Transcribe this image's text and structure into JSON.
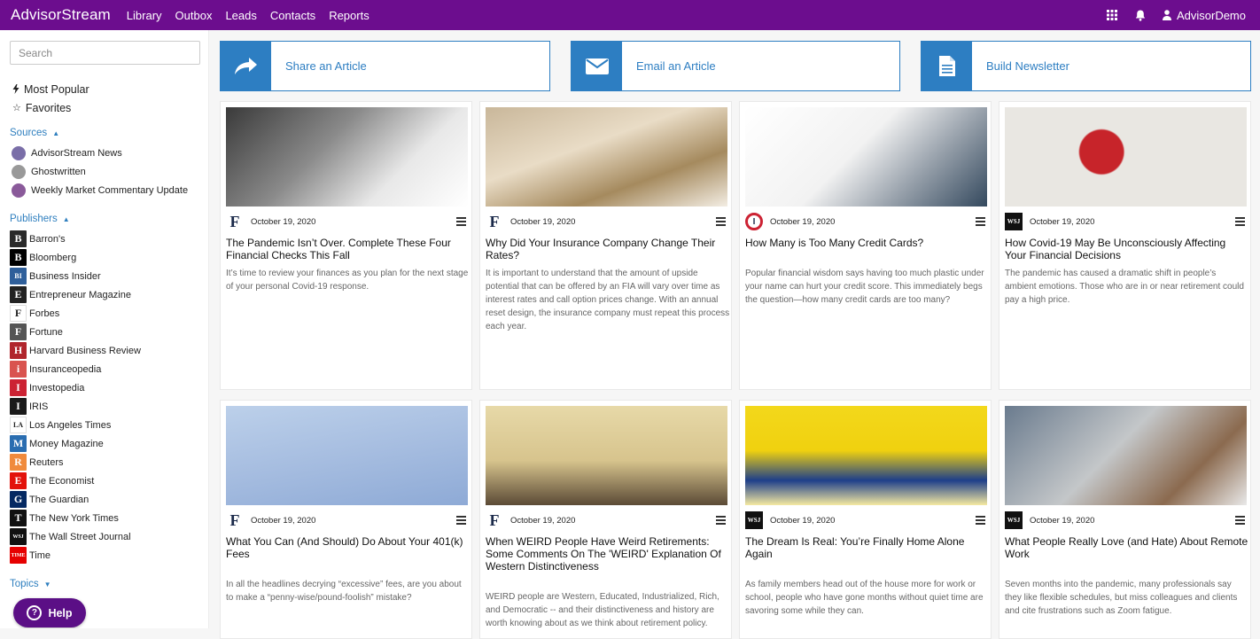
{
  "nav": {
    "brand": "AdvisorStream",
    "links": [
      "Library",
      "Outbox",
      "Leads",
      "Contacts",
      "Reports"
    ],
    "user": "AdvisorDemo"
  },
  "sidebar": {
    "search_placeholder": "Search",
    "quick": [
      {
        "label": "Most Popular",
        "icon": "bolt-icon"
      },
      {
        "label": "Favorites",
        "icon": "star-icon"
      }
    ],
    "sources_heading": "Sources",
    "sources": [
      {
        "label": "AdvisorStream News",
        "color": "#7a6ea8"
      },
      {
        "label": "Ghostwritten",
        "color": "#999999"
      },
      {
        "label": "Weekly Market Commentary Update",
        "color": "#8a5a9a"
      }
    ],
    "publishers_heading": "Publishers",
    "publishers": [
      {
        "label": "Barron's",
        "mark": "B",
        "color": "#2a2a2a"
      },
      {
        "label": "Bloomberg",
        "mark": "B",
        "color": "#000000"
      },
      {
        "label": "Business Insider",
        "mark": "BI",
        "color": "#2f5f9a"
      },
      {
        "label": "Entrepreneur Magazine",
        "mark": "E",
        "color": "#222222"
      },
      {
        "label": "Forbes",
        "mark": "F",
        "color": "#ffffff"
      },
      {
        "label": "Fortune",
        "mark": "F",
        "color": "#555555"
      },
      {
        "label": "Harvard Business Review",
        "mark": "H",
        "color": "#b0252c"
      },
      {
        "label": "Insuranceopedia",
        "mark": "i",
        "color": "#d9534f"
      },
      {
        "label": "Investopedia",
        "mark": "I",
        "color": "#cc2233"
      },
      {
        "label": "IRIS",
        "mark": "I",
        "color": "#1a1a1a"
      },
      {
        "label": "Los Angeles Times",
        "mark": "LA",
        "color": "#ffffff"
      },
      {
        "label": "Money Magazine",
        "mark": "M",
        "color": "#2a6db0"
      },
      {
        "label": "Reuters",
        "mark": "R",
        "color": "#f08a3c"
      },
      {
        "label": "The Economist",
        "mark": "E",
        "color": "#e3120b"
      },
      {
        "label": "The Guardian",
        "mark": "G",
        "color": "#052962"
      },
      {
        "label": "The New York Times",
        "mark": "T",
        "color": "#111111"
      },
      {
        "label": "The Wall Street Journal",
        "mark": "WSJ",
        "color": "#111111"
      },
      {
        "label": "Time",
        "mark": "TIME",
        "color": "#e60000"
      }
    ],
    "topics_heading": "Topics",
    "help_label": "Help"
  },
  "actions": [
    {
      "label": "Share an Article",
      "icon": "share-arrow-icon"
    },
    {
      "label": "Email an Article",
      "icon": "envelope-icon"
    },
    {
      "label": "Build Newsletter",
      "icon": "document-icon"
    }
  ],
  "accent": "#2d7ec2",
  "brand_color": "#6c0d8e",
  "articles": [
    {
      "publisher": "Forbes",
      "date": "October 19, 2020",
      "title": "The Pandemic Isn’t Over. Complete These Four Financial Checks This Fall",
      "desc": "It’s time to review your finances as you plan for the next stage of your personal Covid-19 response."
    },
    {
      "publisher": "Forbes",
      "date": "October 19, 2020",
      "title": "Why Did Your Insurance Company Change Their Rates?",
      "desc": "It is important to understand that the amount of upside potential that can be offered by an FIA will vary over time as interest rates and call option prices change. With an annual reset design, the insurance company must repeat this process each year."
    },
    {
      "publisher": "Investopedia",
      "date": "October 19, 2020",
      "title": "How Many is Too Many Credit Cards?",
      "desc": "Popular financial wisdom says having too much plastic under your name can hurt your credit score. This immediately begs the question—how many credit cards are too many?"
    },
    {
      "publisher": "WSJ",
      "date": "October 19, 2020",
      "title": "How Covid-19 May Be Unconsciously Affecting Your Financial Decisions",
      "desc": "The pandemic has caused a dramatic shift in people’s ambient emotions. Those who are in or near retirement could pay a high price."
    },
    {
      "publisher": "Forbes",
      "date": "October 19, 2020",
      "title": "What You Can (And Should) Do About Your 401(k) Fees",
      "desc": "In all the headlines decrying “excessive” fees, are you about to make a “penny-wise/pound-foolish” mistake?"
    },
    {
      "publisher": "Forbes",
      "date": "October 19, 2020",
      "title": "When WEIRD People Have Weird Retirements: Some Comments On The 'WEIRD' Explanation Of Western Distinctiveness",
      "desc": "WEIRD people are Western, Educated, Industrialized, Rich, and Democratic -- and their distinctiveness and history are worth knowing about as we think about retirement policy."
    },
    {
      "publisher": "WSJ",
      "date": "October 19, 2020",
      "title": "The Dream Is Real: You’re Finally Home Alone Again",
      "desc": "As family members head out of the house more for work or school, people who have gone months without quiet time are savoring some while they can."
    },
    {
      "publisher": "WSJ",
      "date": "October 19, 2020",
      "title": "What People Really Love (and Hate) About Remote Work",
      "desc": "Seven months into the pandemic, many professionals say they like flexible schedules, but miss colleagues and clients and cite frustrations such as Zoom fatigue."
    }
  ]
}
